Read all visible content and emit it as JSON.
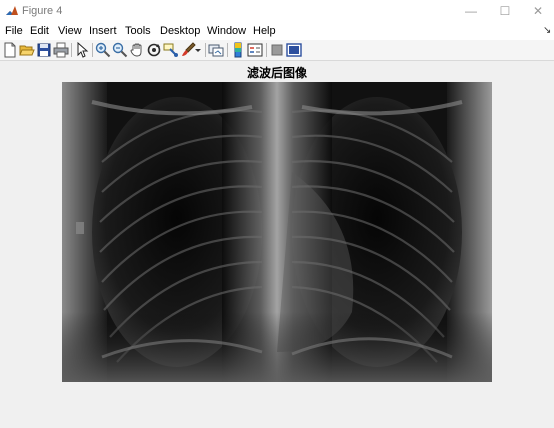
{
  "window": {
    "title": "Figure 4",
    "app_icon": "matlab-logo-icon"
  },
  "window_controls": {
    "minimize": "—",
    "maximize": "☐",
    "close": "✕"
  },
  "menu": {
    "items": [
      {
        "label": "File"
      },
      {
        "label": "Edit"
      },
      {
        "label": "View"
      },
      {
        "label": "Insert"
      },
      {
        "label": "Tools"
      },
      {
        "label": "Desktop"
      },
      {
        "label": "Window"
      },
      {
        "label": "Help"
      }
    ],
    "overflow_icon": "dock-arrow-icon",
    "overflow_glyph": "↘"
  },
  "toolbar": {
    "icons": [
      "new-figure-icon",
      "open-file-icon",
      "save-icon",
      "print-icon",
      "edit-plot-arrow-icon",
      "zoom-in-icon",
      "zoom-out-icon",
      "pan-hand-icon",
      "rotate-3d-icon",
      "data-cursor-icon",
      "brush-icon",
      "brush-dropdown-icon",
      "link-plot-icon",
      "insert-colorbar-icon",
      "insert-legend-icon",
      "hide-plot-tools-icon",
      "show-plot-tools-icon"
    ]
  },
  "figure": {
    "title": "滤波后图像",
    "image_description_icon": "chest-xray-image"
  }
}
